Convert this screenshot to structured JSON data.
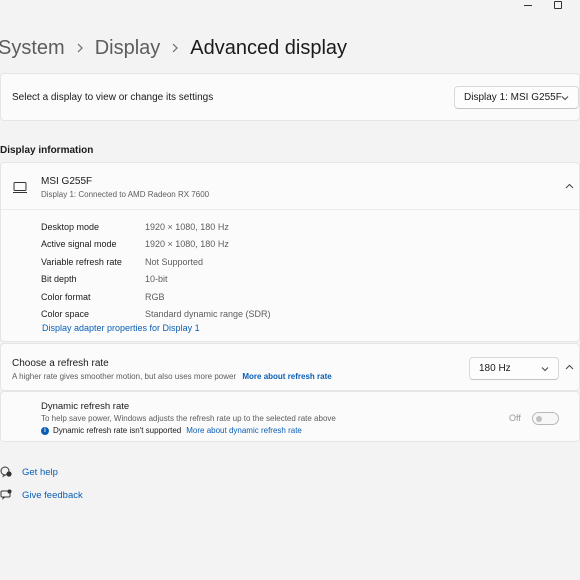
{
  "window": {
    "minimize_icon": "minimize-icon",
    "maximize_icon": "maximize-icon"
  },
  "breadcrumb": {
    "items": [
      "System",
      "Display",
      "Advanced display"
    ]
  },
  "display_select": {
    "label": "Select a display to view or change its settings",
    "selected": "Display 1: MSI G255F"
  },
  "display_info": {
    "section_title": "Display information",
    "monitor_name": "MSI G255F",
    "monitor_subtitle": "Display 1: Connected to AMD Radeon RX 7600",
    "rows": [
      {
        "key": "Desktop mode",
        "value": "1920 × 1080, 180 Hz"
      },
      {
        "key": "Active signal mode",
        "value": "1920 × 1080, 180 Hz"
      },
      {
        "key": "Variable refresh rate",
        "value": "Not Supported"
      },
      {
        "key": "Bit depth",
        "value": "10-bit"
      },
      {
        "key": "Color format",
        "value": "RGB"
      },
      {
        "key": "Color space",
        "value": "Standard dynamic range (SDR)"
      }
    ],
    "adapter_link": "Display adapter properties for Display 1"
  },
  "refresh_rate": {
    "title": "Choose a refresh rate",
    "subtitle": "A higher rate gives smoother motion, but also uses more power",
    "link": "More about refresh rate",
    "selected": "180 Hz"
  },
  "dynamic_refresh": {
    "title": "Dynamic refresh rate",
    "subtitle": "To help save power, Windows adjusts the refresh rate up to the selected rate above",
    "note": "Dynamic refresh rate isn't supported",
    "note_link": "More about dynamic refresh rate",
    "toggle_label": "Off",
    "toggle_on": false
  },
  "footer": {
    "get_help": "Get help",
    "give_feedback": "Give feedback"
  },
  "colors": {
    "accent": "#0a5fb4",
    "background": "#f3f3f3",
    "card": "#fbfbfb"
  }
}
